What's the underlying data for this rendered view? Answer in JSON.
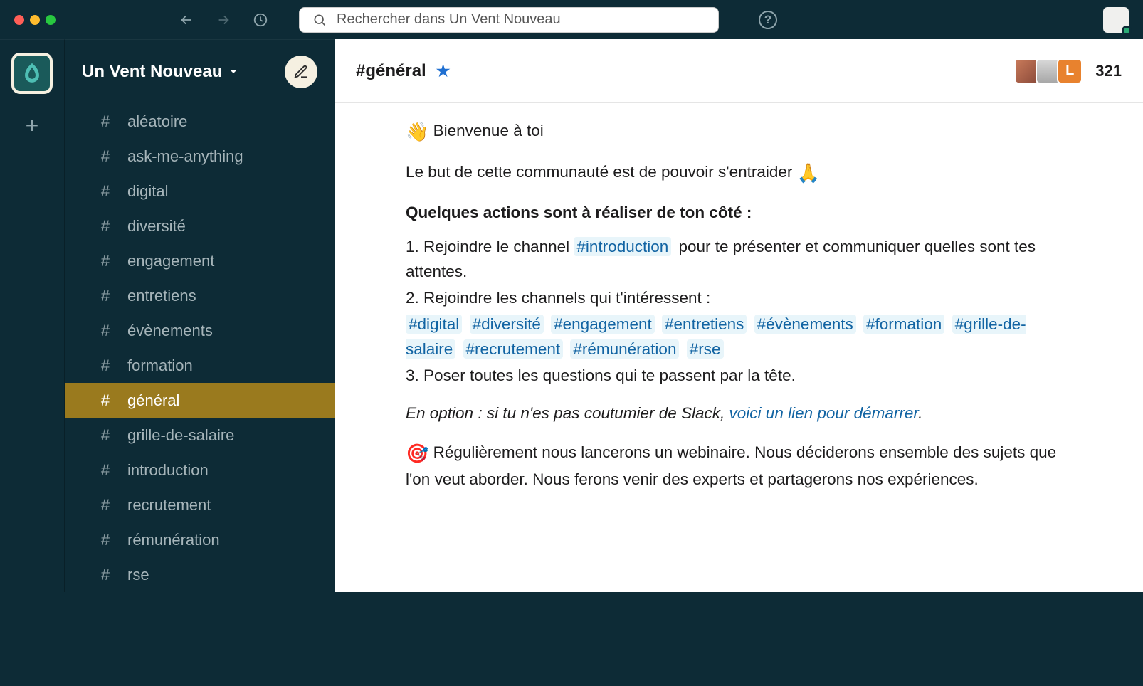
{
  "topbar": {
    "search_placeholder": "Rechercher dans Un Vent Nouveau",
    "help_label": "?"
  },
  "workspace": {
    "name": "Un Vent Nouveau"
  },
  "sidebar": {
    "channels": [
      {
        "id": "aleatoire",
        "label": "aléatoire",
        "active": false
      },
      {
        "id": "ask-me-anything",
        "label": "ask-me-anything",
        "active": false
      },
      {
        "id": "digital",
        "label": "digital",
        "active": false
      },
      {
        "id": "diversite",
        "label": "diversité",
        "active": false
      },
      {
        "id": "engagement",
        "label": "engagement",
        "active": false
      },
      {
        "id": "entretiens",
        "label": "entretiens",
        "active": false
      },
      {
        "id": "evenements",
        "label": "évènements",
        "active": false
      },
      {
        "id": "formation",
        "label": "formation",
        "active": false
      },
      {
        "id": "general",
        "label": "général",
        "active": true
      },
      {
        "id": "grille-de-salaire",
        "label": "grille-de-salaire",
        "active": false
      },
      {
        "id": "introduction",
        "label": "introduction",
        "active": false
      },
      {
        "id": "recrutement",
        "label": "recrutement",
        "active": false
      },
      {
        "id": "remuneration",
        "label": "rémunération",
        "active": false
      },
      {
        "id": "rse",
        "label": "rse",
        "active": false
      }
    ]
  },
  "channel_header": {
    "title": "#général",
    "member_count": "321",
    "avatar_initial": "L"
  },
  "message": {
    "line1_emoji": "👋",
    "line1_text": " Bienvenue à toi",
    "line2_text": "Le but de cette communauté est de pouvoir s'entraider ",
    "line2_emoji": "🙏",
    "bold_heading": "Quelques actions sont à réaliser de ton côté :",
    "item1_pre": "1. Rejoindre le channel ",
    "item1_mention": "#introduction",
    "item1_post": " pour te présenter et communiquer quelles sont tes attentes.",
    "item2_pre": "2. Rejoindre les channels qui t'intéressent :",
    "mentions": [
      "#digital",
      "#diversité",
      "#engagement",
      "#entretiens",
      "#évènements",
      "#formation",
      "#grille-de-salaire",
      "#recrutement",
      "#rémunération",
      "#rse"
    ],
    "item3": "3. Poser toutes les questions qui te passent par la tête.",
    "option_pre": "En option : si tu n'es pas coutumier de Slack, ",
    "option_link": "voici un lien pour démarrer",
    "option_post": ".",
    "webinar_emoji": "🎯",
    "webinar_text": " Régulièrement nous lancerons un webinaire. Nous déciderons ensemble des sujets que l'on veut aborder. Nous ferons venir des experts et partagerons nos expériences."
  }
}
